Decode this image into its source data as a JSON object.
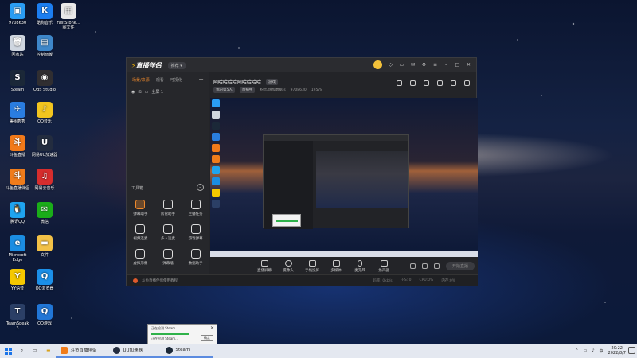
{
  "desktop": {
    "icons": [
      {
        "label": "9708630",
        "color": "#2a9df4",
        "glyph": "▣"
      },
      {
        "label": "酷狗音乐",
        "color": "#1c7ef0",
        "glyph": "K"
      },
      {
        "label": "FastStone...\n图文件",
        "color": "#e8e8e8",
        "glyph": "▦"
      },
      {
        "label": "回收站",
        "color": "#cfd6e0",
        "glyph": "🗑"
      },
      {
        "label": "控制面板",
        "color": "#3e87c9",
        "glyph": "▤"
      },
      {
        "label": "Steam",
        "color": "#1b2838",
        "glyph": "S"
      },
      {
        "label": "OBS Studio",
        "color": "#302e31",
        "glyph": "◉"
      },
      {
        "label": "美图秀秀",
        "color": "#2a7de1",
        "glyph": "✈"
      },
      {
        "label": "QQ音乐",
        "color": "#f2c51f",
        "glyph": "♪"
      },
      {
        "label": "斗鱼直播",
        "color": "#f27a1a",
        "glyph": "斗"
      },
      {
        "label": "网易UU加速器",
        "color": "#232c3f",
        "glyph": "U"
      },
      {
        "label": "斗鱼直播伴侣",
        "color": "#f07c1b",
        "glyph": "斗"
      },
      {
        "label": "网易云音乐",
        "color": "#d62d2d",
        "glyph": "♫"
      },
      {
        "label": "腾讯QQ",
        "color": "#1fa4f0",
        "glyph": "🐧"
      },
      {
        "label": "微信",
        "color": "#1aad19",
        "glyph": "✉"
      },
      {
        "label": "Microsoft\nEdge",
        "color": "#1b8de2",
        "glyph": "e"
      },
      {
        "label": "文件",
        "color": "#f2c147",
        "glyph": "▬"
      },
      {
        "label": "YY语音",
        "color": "#f5c800",
        "glyph": "Y"
      },
      {
        "label": "QQ浏览器",
        "color": "#1b8fe8",
        "glyph": "Q"
      },
      {
        "label": "TeamSpeak\n3",
        "color": "#2b3f66",
        "glyph": "T"
      },
      {
        "label": "QQ游戏",
        "color": "#2176d6",
        "glyph": "Q"
      }
    ]
  },
  "app": {
    "logo": "直播伴侣",
    "version": "推荐 ▾",
    "left_tabs": [
      "场景/来源",
      "观看",
      "可视化"
    ],
    "scene_name": "全屏 1",
    "tools_title": "工具箱",
    "tools": [
      {
        "label": "弹幕助手",
        "accent": true
      },
      {
        "label": "房管助手",
        "accent": false
      },
      {
        "label": "主播任务",
        "accent": false
      },
      {
        "label": "视频连麦",
        "accent": false
      },
      {
        "label": "多人连麦",
        "accent": false
      },
      {
        "label": "游戏弹幕",
        "accent": false
      },
      {
        "label": "虚拟形象",
        "accent": false
      },
      {
        "label": "弹幕墙",
        "accent": false
      },
      {
        "label": "数据助手",
        "accent": false
      }
    ],
    "room_title": "阿哈哈哈哈阿哈哈哈哈",
    "room_tag": "游戏",
    "room_info": [
      "我的第5人",
      "直播中",
      "粉丝/增加数据 s",
      "9708630",
      "19578"
    ],
    "controls": [
      "直播屏幕",
      "摄像头",
      "手机投屏",
      "多媒体",
      "麦克风",
      "扬声器"
    ],
    "go_live": "开始直播",
    "status_text": "斗鱼直播伴侣使用教程",
    "stats": [
      "码率: 0kb/s",
      "FPS: 0",
      "CPU:0%",
      "内存:0%"
    ]
  },
  "popup": {
    "line1": "正在检测 Steam...",
    "line2": "正在检测 Steam...",
    "ok": "确定"
  },
  "taskbar": {
    "items": [
      {
        "label": "斗鱼直播伴侣",
        "color": "#f07c1b"
      },
      {
        "label": "UU加速器",
        "color": "#232c3f"
      },
      {
        "label": "Steam",
        "color": "#1b2838"
      }
    ],
    "time": "20:22",
    "date": "2022/8/7",
    "lang": "中"
  }
}
